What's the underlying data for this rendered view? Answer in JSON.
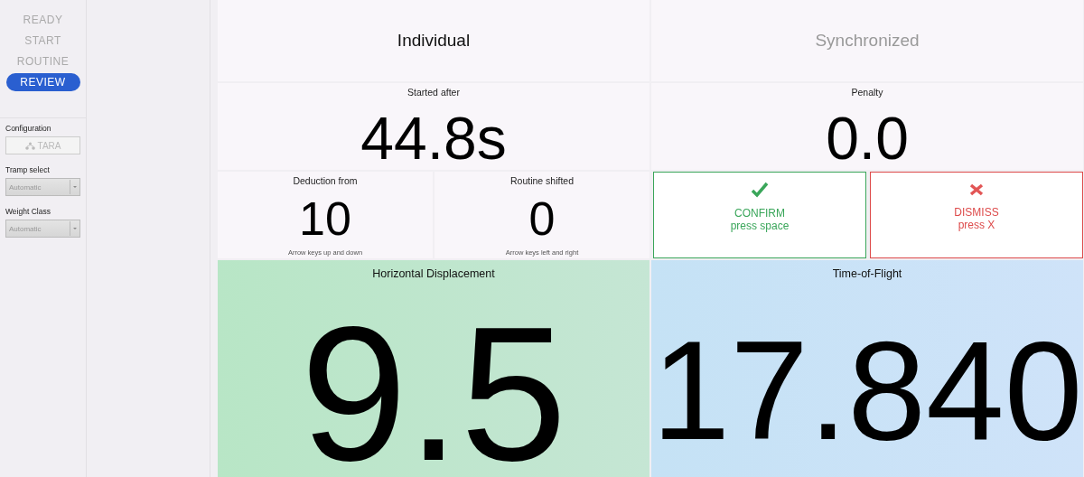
{
  "nav": [
    {
      "label": "READY",
      "selected": false
    },
    {
      "label": "START",
      "selected": false
    },
    {
      "label": "ROUTINE",
      "selected": false
    },
    {
      "label": "REVIEW",
      "selected": true
    }
  ],
  "configuration": {
    "title": "Configuration",
    "button": "TARA",
    "fields": [
      {
        "label": "Tramp select",
        "value": "Automatic"
      },
      {
        "label": "Weight Class",
        "value": "Automatic"
      }
    ]
  },
  "modes": [
    {
      "label": "Individual",
      "selected": true
    },
    {
      "label": "Synchronized",
      "selected": false
    }
  ],
  "stats": [
    {
      "label": "Started after",
      "value": "44.8s",
      "kind": "large"
    },
    {
      "label": "Penalty",
      "value": "0.0",
      "kind": "large"
    },
    {
      "label": "Deduction from",
      "value": "10",
      "hint": "Arrow keys up and down",
      "kind": "medium"
    },
    {
      "label": "Routine shifted",
      "value": "0",
      "hint": "Arrow keys left and right",
      "kind": "medium"
    }
  ],
  "actions": [
    {
      "kind": "confirm",
      "label": "CONFIRM",
      "hint": "press space"
    },
    {
      "kind": "dismiss",
      "label": "DISMISS",
      "hint": "press X"
    }
  ],
  "results": [
    {
      "title": "Horizontal Displacement",
      "value": "9.5",
      "kind": "displacement"
    },
    {
      "title": "Time-of-Flight",
      "value": "17.840",
      "kind": "time"
    }
  ]
}
